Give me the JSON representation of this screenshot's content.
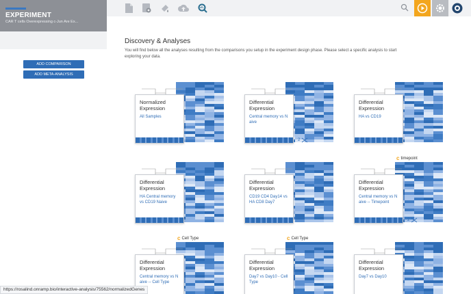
{
  "sidebar": {
    "title": "EXPERIMENT",
    "subtitle": "CAR T cells Overexpressing c-Jun Are Ex...",
    "buttons": {
      "add_comparison": "ADD COMPARISON",
      "add_meta": "ADD META-ANALYSIS"
    }
  },
  "toolbar": {
    "icons": [
      "document-icon",
      "settings-document-icon",
      "paint-icon",
      "cloud-upload-icon",
      "analysis-search-icon",
      "search-icon",
      "play-icon",
      "gear-icon",
      "brand-icon"
    ],
    "colors": {
      "play": "#f3a61e",
      "gear": "#b9bcc1",
      "accent": "#2f6db6"
    }
  },
  "main": {
    "title": "Discovery & Analyses",
    "description": "You will find below all the analyses resulting from the comparisons you setup in the experiment design phase. Please select a specific analysis to start exploring your data."
  },
  "cards": [
    {
      "title1": "Normalized",
      "title2": "Expression",
      "subtitle": "All Samples",
      "badge": "",
      "meta": ""
    },
    {
      "title1": "Differential",
      "title2": "Expression",
      "subtitle": "Central memory vs N aive",
      "badge": "",
      "meta": "2"
    },
    {
      "title1": "Differential",
      "title2": "Expression",
      "subtitle": "HA vs CD19",
      "badge": "",
      "meta": ""
    },
    {
      "title1": "Differential",
      "title2": "Expression",
      "subtitle": "HA Central memory vs CD19 Naive",
      "badge": "",
      "meta": ""
    },
    {
      "title1": "Differential",
      "title2": "Expression",
      "subtitle": "CD19 CD4 Day14 vs HA CD8 Day7",
      "badge": "",
      "meta": ""
    },
    {
      "title1": "Differential",
      "title2": "Expression",
      "subtitle": "Central memory vs N aive -- Timepoint",
      "badge": "timepoint",
      "meta": "2"
    },
    {
      "title1": "Differential",
      "title2": "Expression",
      "subtitle": "Central memory vs N aive -- Cell Type",
      "badge": "Cell Type",
      "meta": ""
    },
    {
      "title1": "Differential",
      "title2": "Expression",
      "subtitle": "Day7 vs Day10 - Cell Type",
      "badge": "Cell Type",
      "meta": ""
    },
    {
      "title1": "Differential",
      "title2": "Expression",
      "subtitle": "Day7 vs Day10",
      "badge": "",
      "meta": ""
    }
  ],
  "status": {
    "url": "https://rosalind.onramp.bio/interactive-analysis/75562/normalizedGenes"
  }
}
